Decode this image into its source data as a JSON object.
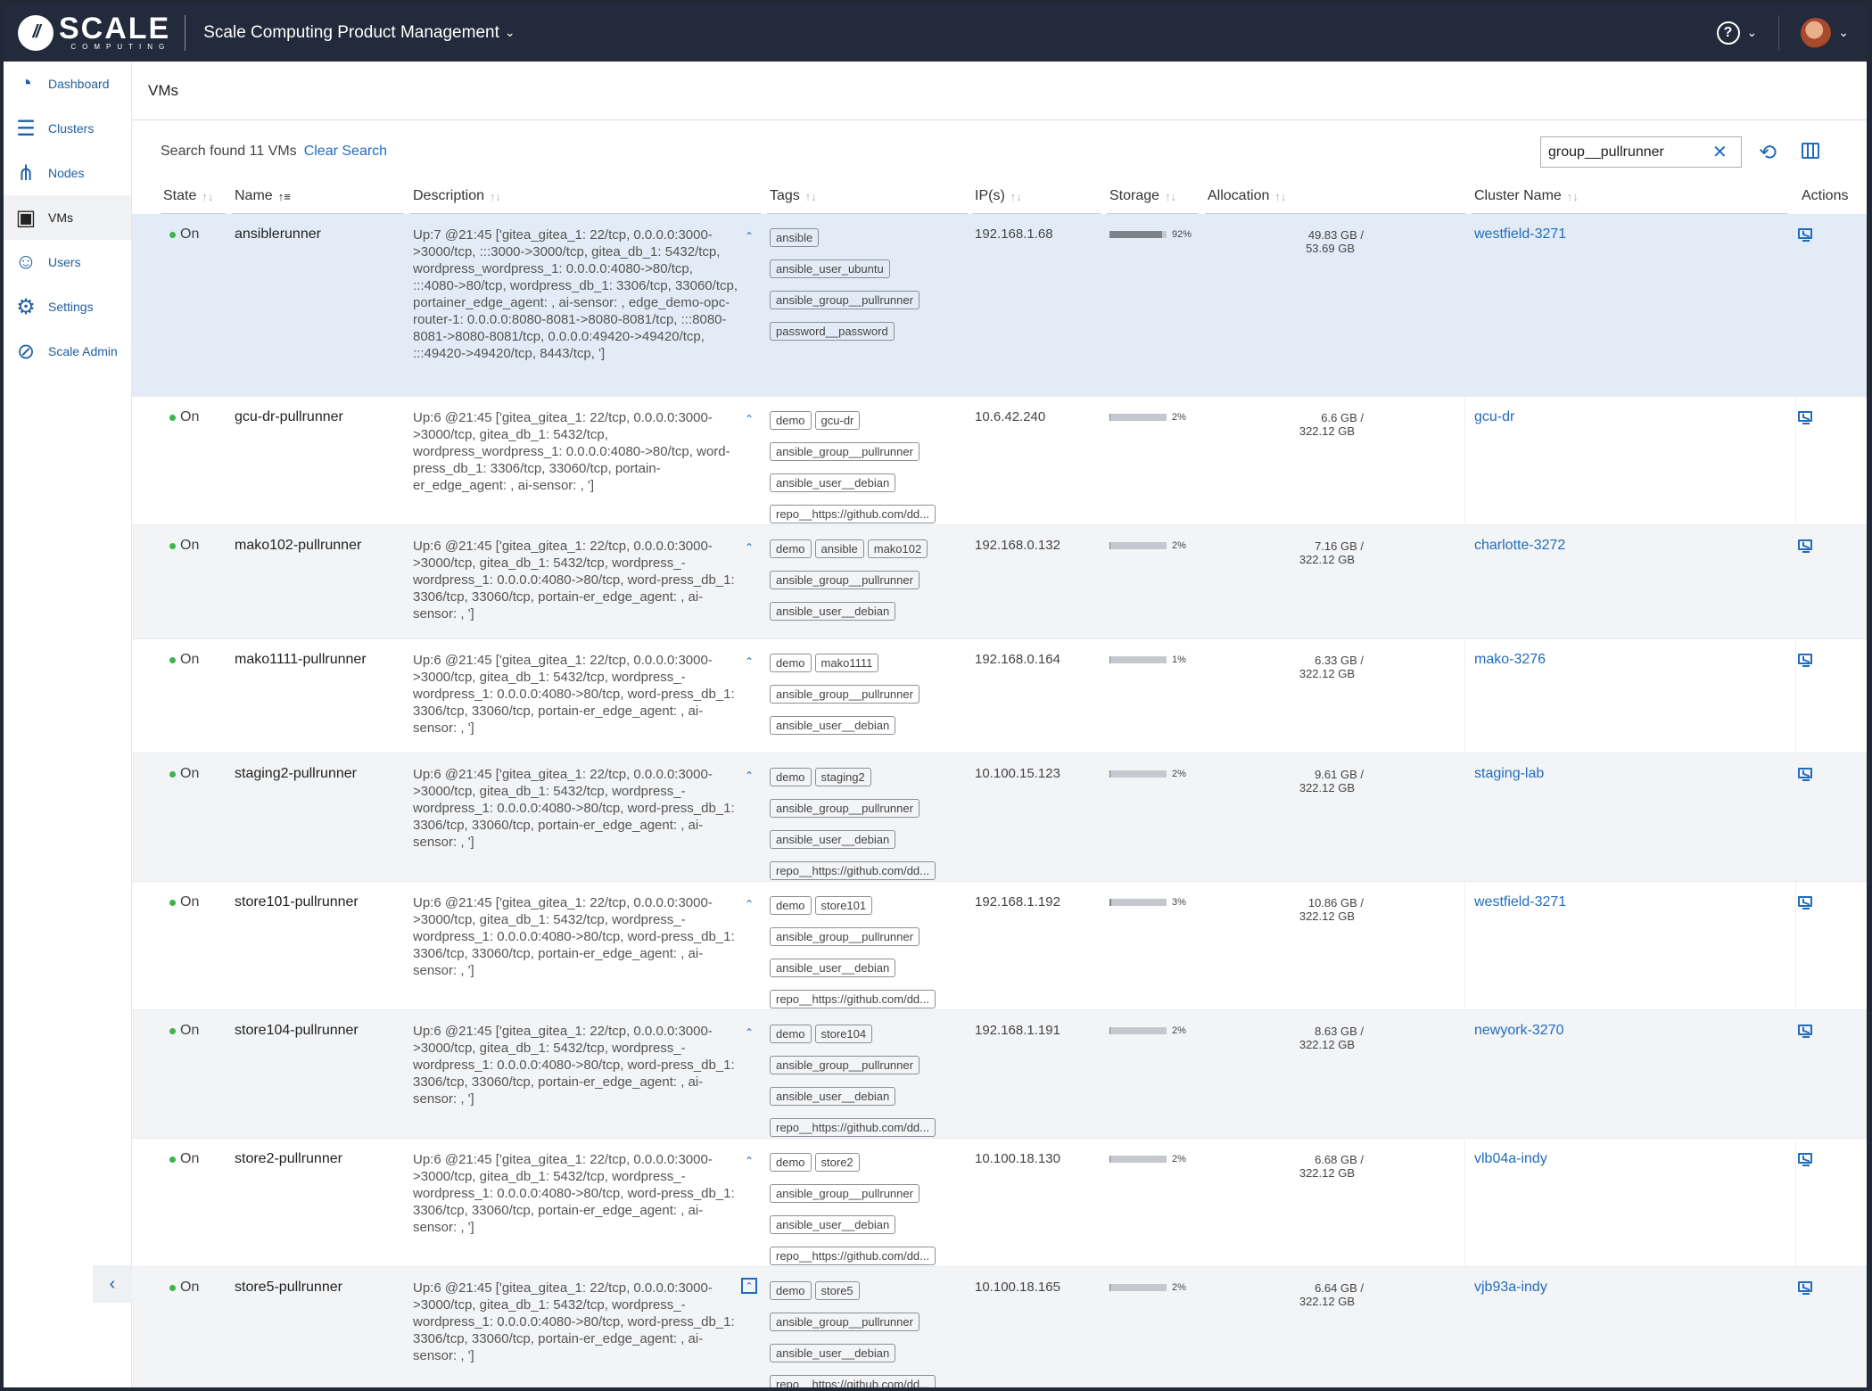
{
  "header": {
    "logo_text": "SCALE",
    "logo_subtext": "COMPUTING",
    "org_name": "Scale Computing Product Management",
    "help_label": "?"
  },
  "sidebar": {
    "items": [
      {
        "label": "Dashboard",
        "icon": "gauge-icon"
      },
      {
        "label": "Clusters",
        "icon": "cluster-icon"
      },
      {
        "label": "Nodes",
        "icon": "nodes-icon"
      },
      {
        "label": "VMs",
        "icon": "vm-icon"
      },
      {
        "label": "Users",
        "icon": "users-icon"
      },
      {
        "label": "Settings",
        "icon": "gear-icon"
      },
      {
        "label": "Scale Admin",
        "icon": "admin-icon"
      }
    ],
    "active": "VMs",
    "collapse_icon": "chevron-left-icon"
  },
  "page": {
    "title": "VMs",
    "search_result": "Search found 11 VMs",
    "clear_search": "Clear Search",
    "search_value": "group__pullrunner"
  },
  "columns": {
    "state": "State",
    "name": "Name",
    "description": "Description",
    "tags": "Tags",
    "ips": "IP(s)",
    "storage": "Storage",
    "allocation": "Allocation",
    "cluster": "Cluster Name",
    "actions": "Actions"
  },
  "colors": {
    "accent": "#1f6cbf",
    "topbar": "#222a3b",
    "state_on": "#3cb54a",
    "selected_row": "#e3ecf6"
  },
  "rows": [
    {
      "state": "On",
      "name": "ansiblerunner",
      "description": "Up:7 @21:45 ['gitea_gitea_1: 22/tcp, 0.0.0.0:3000->3000/tcp, :::3000->3000/tcp, gitea_db_1: 5432/tcp, wordpress_wordpress_1: 0.0.0.0:4080->80/tcp, :::4080->80/tcp, wordpress_db_1: 3306/tcp, 33060/tcp, portainer_edge_agent: , ai-sensor: , edge_demo-opc-router-1: 0.0.0.0:8080-8081->8080-8081/tcp, :::8080-8081->8080-8081/tcp, 0.0.0.0:49420->49420/tcp, :::49420->49420/tcp, 8443/tcp, ']",
      "tags": [
        "ansible",
        "|",
        "ansible_user_ubuntu",
        "|",
        "ansible_group__pullrunner",
        "|",
        "password__password"
      ],
      "ip": "192.168.1.68",
      "storage_pct": 92,
      "storage_label": "92%",
      "alloc_used": "49.83 GB /",
      "alloc_total": "53.69 GB",
      "cluster": "westfield-3271"
    },
    {
      "state": "On",
      "name": "gcu-dr-pullrunner",
      "description": "Up:6 @21:45 ['gitea_gitea_1: 22/tcp, 0.0.0.0:3000->3000/tcp, gitea_db_1: 5432/tcp, wordpress_wordpress_1: 0.0.0.0:4080->80/tcp, word-press_db_1: 3306/tcp, 33060/tcp, portain-er_edge_agent: , ai-sensor: , ']",
      "tags": [
        "demo",
        "gcu-dr",
        "|",
        "ansible_group__pullrunner",
        "|",
        "ansible_user__debian",
        "|",
        "repo__https://github.com/dd..."
      ],
      "ip": "10.6.42.240",
      "storage_pct": 2,
      "storage_label": "2%",
      "alloc_used": "6.6 GB /",
      "alloc_total": "322.12 GB",
      "cluster": "gcu-dr"
    },
    {
      "state": "On",
      "name": "mako102-pullrunner",
      "description": "Up:6 @21:45 ['gitea_gitea_1: 22/tcp, 0.0.0.0:3000->3000/tcp, gitea_db_1: 5432/tcp, wordpress_-wordpress_1: 0.0.0.0:4080->80/tcp, word-press_db_1: 3306/tcp, 33060/tcp, portain-er_edge_agent: , ai-sensor: , ']",
      "tags": [
        "demo",
        "ansible",
        "mako102",
        "|",
        "ansible_group__pullrunner",
        "|",
        "ansible_user__debian"
      ],
      "ip": "192.168.0.132",
      "storage_pct": 2,
      "storage_label": "2%",
      "alloc_used": "7.16 GB /",
      "alloc_total": "322.12 GB",
      "cluster": "charlotte-3272"
    },
    {
      "state": "On",
      "name": "mako1111-pullrunner",
      "description": "Up:6 @21:45 ['gitea_gitea_1: 22/tcp, 0.0.0.0:3000->3000/tcp, gitea_db_1: 5432/tcp, wordpress_-wordpress_1: 0.0.0.0:4080->80/tcp, word-press_db_1: 3306/tcp, 33060/tcp, portain-er_edge_agent: , ai-sensor: , ']",
      "tags": [
        "demo",
        "mako1111",
        "|",
        "ansible_group__pullrunner",
        "|",
        "ansible_user__debian"
      ],
      "ip": "192.168.0.164",
      "storage_pct": 1,
      "storage_label": "1%",
      "alloc_used": "6.33 GB /",
      "alloc_total": "322.12 GB",
      "cluster": "mako-3276"
    },
    {
      "state": "On",
      "name": "staging2-pullrunner",
      "description": "Up:6 @21:45 ['gitea_gitea_1: 22/tcp, 0.0.0.0:3000->3000/tcp, gitea_db_1: 5432/tcp, wordpress_-wordpress_1: 0.0.0.0:4080->80/tcp, word-press_db_1: 3306/tcp, 33060/tcp, portain-er_edge_agent: , ai-sensor: , ']",
      "tags": [
        "demo",
        "staging2",
        "|",
        "ansible_group__pullrunner",
        "|",
        "ansible_user__debian",
        "|",
        "repo__https://github.com/dd..."
      ],
      "ip": "10.100.15.123",
      "storage_pct": 2,
      "storage_label": "2%",
      "alloc_used": "9.61 GB /",
      "alloc_total": "322.12 GB",
      "cluster": "staging-lab"
    },
    {
      "state": "On",
      "name": "store101-pullrunner",
      "description": "Up:6 @21:45 ['gitea_gitea_1: 22/tcp, 0.0.0.0:3000->3000/tcp, gitea_db_1: 5432/tcp, wordpress_-wordpress_1: 0.0.0.0:4080->80/tcp, word-press_db_1: 3306/tcp, 33060/tcp, portain-er_edge_agent: , ai-sensor: , ']",
      "tags": [
        "demo",
        "store101",
        "|",
        "ansible_group__pullrunner",
        "|",
        "ansible_user__debian",
        "|",
        "repo__https://github.com/dd..."
      ],
      "ip": "192.168.1.192",
      "storage_pct": 3,
      "storage_label": "3%",
      "alloc_used": "10.86 GB /",
      "alloc_total": "322.12 GB",
      "cluster": "westfield-3271"
    },
    {
      "state": "On",
      "name": "store104-pullrunner",
      "description": "Up:6 @21:45 ['gitea_gitea_1: 22/tcp, 0.0.0.0:3000->3000/tcp, gitea_db_1: 5432/tcp, wordpress_-wordpress_1: 0.0.0.0:4080->80/tcp, word-press_db_1: 3306/tcp, 33060/tcp, portain-er_edge_agent: , ai-sensor: , ']",
      "tags": [
        "demo",
        "store104",
        "|",
        "ansible_group__pullrunner",
        "|",
        "ansible_user__debian",
        "|",
        "repo__https://github.com/dd..."
      ],
      "ip": "192.168.1.191",
      "storage_pct": 2,
      "storage_label": "2%",
      "alloc_used": "8.63 GB /",
      "alloc_total": "322.12 GB",
      "cluster": "newyork-3270"
    },
    {
      "state": "On",
      "name": "store2-pullrunner",
      "description": "Up:6 @21:45 ['gitea_gitea_1: 22/tcp, 0.0.0.0:3000->3000/tcp, gitea_db_1: 5432/tcp, wordpress_-wordpress_1: 0.0.0.0:4080->80/tcp, word-press_db_1: 3306/tcp, 33060/tcp, portain-er_edge_agent: , ai-sensor: , ']",
      "tags": [
        "demo",
        "store2",
        "|",
        "ansible_group__pullrunner",
        "|",
        "ansible_user__debian",
        "|",
        "repo__https://github.com/dd..."
      ],
      "ip": "10.100.18.130",
      "storage_pct": 2,
      "storage_label": "2%",
      "alloc_used": "6.68 GB /",
      "alloc_total": "322.12 GB",
      "cluster": "vlb04a-indy"
    },
    {
      "state": "On",
      "name": "store5-pullrunner",
      "description": "Up:6 @21:45 ['gitea_gitea_1: 22/tcp, 0.0.0.0:3000->3000/tcp, gitea_db_1: 5432/tcp, wordpress_-wordpress_1: 0.0.0.0:4080->80/tcp, word-press_db_1: 3306/tcp, 33060/tcp, portain-er_edge_agent: , ai-sensor: , ']",
      "tags": [
        "demo",
        "store5",
        "|",
        "ansible_group__pullrunner",
        "|",
        "ansible_user__debian",
        "|",
        "repo__https://github.com/dd..."
      ],
      "ip": "10.100.18.165",
      "storage_pct": 2,
      "storage_label": "2%",
      "alloc_used": "6.64 GB /",
      "alloc_total": "322.12 GB",
      "cluster": "vjb93a-indy"
    }
  ]
}
